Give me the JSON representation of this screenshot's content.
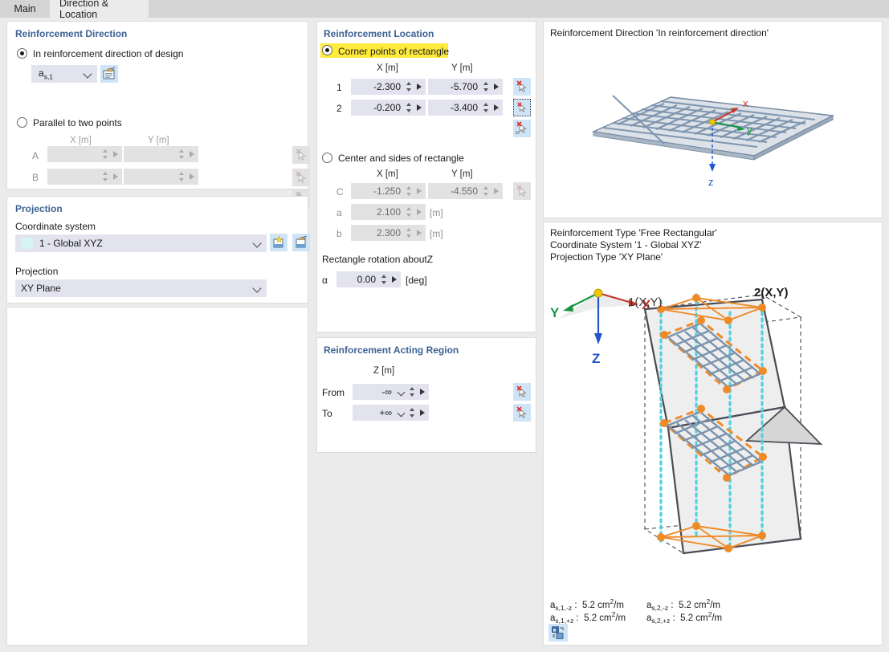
{
  "tabs": [
    {
      "label": "Main",
      "active": false
    },
    {
      "label": "Direction & Location",
      "active": true
    }
  ],
  "reinforcement_direction": {
    "title": "Reinforcement Direction",
    "option_design": "In reinforcement direction of design",
    "design_selected": true,
    "design_combo_value": "a",
    "design_combo_sub": "s,1",
    "option_parallel": "Parallel to two points",
    "parallel_selected": false,
    "col_x": "X [m]",
    "col_y": "Y [m]",
    "rows": [
      {
        "label": "A",
        "x": "",
        "y": ""
      },
      {
        "label": "B",
        "x": "",
        "y": ""
      }
    ]
  },
  "projection": {
    "title": "Projection",
    "coordinate_system_label": "Coordinate system",
    "coordinate_system_value": "1 - Global XYZ",
    "swatch_color": "#d6f4f6",
    "projection_label": "Projection",
    "projection_value": "XY Plane"
  },
  "reinforcement_location": {
    "title": "Reinforcement Location",
    "option_corner": "Corner points of rectangle",
    "corner_selected": true,
    "corner_highlight_color": "#ffeb3b",
    "col_x": "X [m]",
    "col_y": "Y [m]",
    "corner_rows": [
      {
        "label": "1",
        "x": "-2.300",
        "y": "-5.700"
      },
      {
        "label": "2",
        "x": "-0.200",
        "y": "-3.400"
      }
    ],
    "option_center": "Center and sides of rectangle",
    "center_selected": false,
    "center_col_x": "X [m]",
    "center_col_y": "Y [m]",
    "center_rows": [
      {
        "label": "C",
        "x": "-1.250",
        "y": "-4.550"
      }
    ],
    "side_a_label": "a",
    "side_a_value": "2.100",
    "side_a_unit": "[m]",
    "side_b_label": "b",
    "side_b_value": "2.300",
    "side_b_unit": "[m]",
    "rotation_label": "Rectangle rotation aboutZ",
    "rotation_symbol": "α",
    "rotation_value": "0.00",
    "rotation_unit": "[deg]"
  },
  "acting_region": {
    "title": "Reinforcement Acting Region",
    "col_z": "Z [m]",
    "from_label": "From",
    "from_value": "-∞",
    "to_label": "To",
    "to_value": "+∞"
  },
  "view_top": {
    "caption": "Reinforcement Direction 'In reinforcement direction'",
    "axis_x": "x",
    "axis_y": "y",
    "axis_z": "z"
  },
  "view_bottom": {
    "caption_line1": "Reinforcement Type 'Free Rectangular'",
    "caption_line2": "Coordinate System '1 - Global XYZ'",
    "caption_line3": "Projection Type 'XY Plane'",
    "axis_x": "X",
    "axis_y": "Y",
    "axis_z": "Z",
    "point_label_1": "1(X,Y)",
    "point_label_2": "2(X,Y)",
    "results": [
      {
        "symbol": "a",
        "sub": "s,1,-z",
        "value": "5.2 cm",
        "unit_sup": "2",
        "unit_rest": "/m"
      },
      {
        "symbol": "a",
        "sub": "s,2,-z",
        "value": "5.2 cm",
        "unit_sup": "2",
        "unit_rest": "/m"
      },
      {
        "symbol": "a",
        "sub": "s,1,+z",
        "value": "5.2 cm",
        "unit_sup": "2",
        "unit_rest": "/m"
      },
      {
        "symbol": "a",
        "sub": "s,2,+z",
        "value": "5.2 cm",
        "unit_sup": "2",
        "unit_rest": "/m"
      }
    ]
  },
  "colors": {
    "accent_title": "#3c6293",
    "field_bg": "#e3e3ef",
    "field_disabled_bg": "#e2e2e2",
    "iconbtn_bg": "#cfe4f7",
    "highlight": "#ffeb3b",
    "axis_x": "#c0392b",
    "axis_y": "#1a9641",
    "axis_z": "#2255cc",
    "mesh": "#7b93ad",
    "orange": "#ef8a27",
    "cyan": "#4fd0e0"
  }
}
